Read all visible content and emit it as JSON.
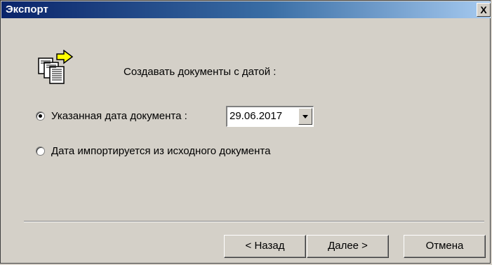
{
  "window": {
    "title": "Экспорт",
    "close_label": "X"
  },
  "icons": {
    "main": "documents-export-icon"
  },
  "heading": "Создавать документы с датой :",
  "options": {
    "specified": {
      "label": "Указанная дата документа :",
      "checked": true
    },
    "imported": {
      "label": "Дата импортируется из исходного документа",
      "checked": false
    }
  },
  "date_field": {
    "value": "29.06.2017"
  },
  "buttons": {
    "back": "< Назад",
    "next": "Далее >",
    "cancel": "Отмена"
  }
}
